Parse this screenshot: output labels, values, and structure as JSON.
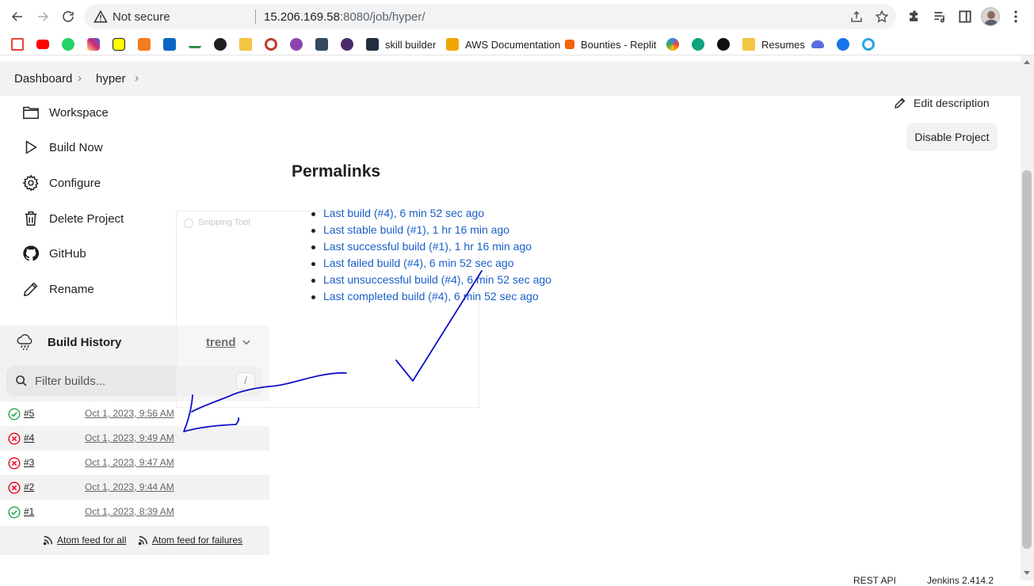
{
  "browser": {
    "security_label": "Not secure",
    "url_host": "15.206.169.58",
    "url_rest": ":8080/job/hyper/",
    "bookmarks": [
      {
        "icon": "gmail-icon",
        "label": "",
        "color": "#ea4335"
      },
      {
        "icon": "youtube-icon",
        "label": "",
        "color": "#ff0000"
      },
      {
        "icon": "whatsapp-icon",
        "label": "",
        "color": "#25d366"
      },
      {
        "icon": "instagram-icon",
        "label": "",
        "color": "#d62976"
      },
      {
        "icon": "snapchat-icon",
        "label": "",
        "color": "#fffc00"
      },
      {
        "icon": "cube-icon",
        "label": "",
        "color": "#f47b20"
      },
      {
        "icon": "linkedin-icon",
        "label": "",
        "color": "#0a66c2"
      },
      {
        "icon": "geeksforgeeks-icon",
        "label": "",
        "color": "#2f8d46"
      },
      {
        "icon": "github-icon",
        "label": "",
        "color": "#1f1f1f"
      },
      {
        "icon": "folder-icon",
        "label": "",
        "color": "#f4c542"
      },
      {
        "icon": "red-logo-icon",
        "label": "",
        "color": "#c0392b"
      },
      {
        "icon": "circle-logo-icon",
        "label": "",
        "color": "#8e44ad"
      },
      {
        "icon": "camera-icon",
        "label": "",
        "color": "#34495e"
      },
      {
        "icon": "vue-icon",
        "label": "",
        "color": "#4a2c6b"
      },
      {
        "icon": "aws-icon",
        "label": "skill builder",
        "color": "#232f3e"
      },
      {
        "icon": "aws-box-icon",
        "label": "AWS Documentation",
        "color": "#f0a500"
      },
      {
        "icon": "replit-icon",
        "label": "Bounties - Replit",
        "color": "#f26207"
      },
      {
        "icon": "colorful-circle-icon",
        "label": "",
        "color": "#4285f4"
      },
      {
        "icon": "chatgpt-icon",
        "label": "",
        "color": "#10a37f"
      },
      {
        "icon": "star-badge-icon",
        "label": "",
        "color": "#111111"
      },
      {
        "icon": "folder-icon",
        "label": "Resumes",
        "color": "#f4c542"
      },
      {
        "icon": "cloud-icon",
        "label": "",
        "color": "#5b6ee1"
      },
      {
        "icon": "c-logo-icon",
        "label": "",
        "color": "#1a73e8"
      },
      {
        "icon": "ring-icon",
        "label": "",
        "color": "#2aa5e0"
      }
    ]
  },
  "breadcrumb": {
    "items": [
      "Dashboard",
      "hyper"
    ]
  },
  "sidebar": {
    "tasks": [
      {
        "icon": "folder-icon",
        "label": "Workspace"
      },
      {
        "icon": "play-icon",
        "label": "Build Now"
      },
      {
        "icon": "gear-icon",
        "label": "Configure"
      },
      {
        "icon": "trash-icon",
        "label": "Delete Project"
      },
      {
        "icon": "github-icon",
        "label": "GitHub"
      },
      {
        "icon": "pencil-icon",
        "label": "Rename"
      }
    ]
  },
  "build_history": {
    "title": "Build History",
    "trend_label": "trend",
    "filter_placeholder": "Filter builds...",
    "filter_shortcut": "/",
    "builds": [
      {
        "number": "#5",
        "date": "Oct 1, 2023, 9:56 AM",
        "status": "success"
      },
      {
        "number": "#4",
        "date": "Oct 1, 2023, 9:49 AM",
        "status": "failed"
      },
      {
        "number": "#3",
        "date": "Oct 1, 2023, 9:47 AM",
        "status": "failed"
      },
      {
        "number": "#2",
        "date": "Oct 1, 2023, 9:44 AM",
        "status": "failed"
      },
      {
        "number": "#1",
        "date": "Oct 1, 2023, 8:39 AM",
        "status": "success"
      }
    ],
    "feed_all": "Atom feed for all",
    "feed_failures": "Atom feed for failures",
    "status_colors": {
      "success": "#1ea64b",
      "failed": "#e6001f"
    }
  },
  "snipping_tool": {
    "label": "Snipping Tool"
  },
  "main": {
    "edit_description": "Edit description",
    "disable_project": "Disable Project",
    "permalinks_title": "Permalinks",
    "permalinks": [
      "Last build (#4), 6 min 52 sec ago",
      "Last stable build (#1), 1 hr 16 min ago",
      "Last successful build (#1), 1 hr 16 min ago",
      "Last failed build (#4), 6 min 52 sec ago",
      "Last unsuccessful build (#4), 6 min 52 sec ago",
      "Last completed build (#4), 6 min 52 sec ago"
    ],
    "link_color": "#1a5fc9"
  },
  "footer": {
    "rest_api": "REST API",
    "version": "Jenkins 2.414.2"
  },
  "annotation_color": "#1010c8"
}
